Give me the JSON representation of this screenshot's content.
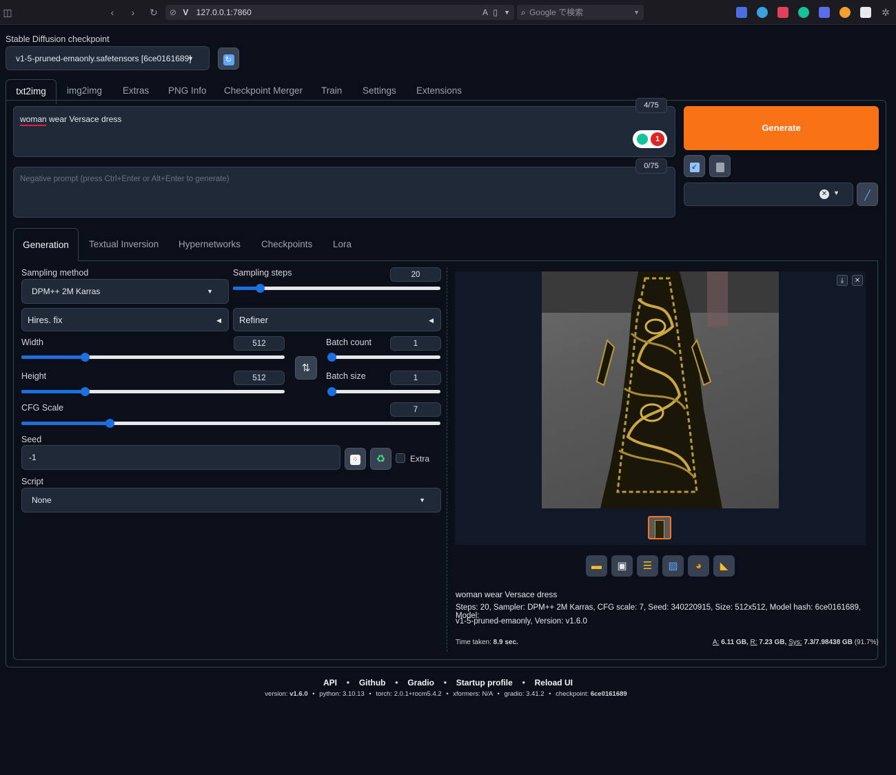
{
  "browser": {
    "url": "127.0.0.1:7860",
    "search_placeholder": "Google で検索"
  },
  "checkpoint": {
    "label": "Stable Diffusion checkpoint",
    "value": "v1-5-pruned-emaonly.safetensors [6ce0161689]"
  },
  "main_tabs": [
    "txt2img",
    "img2img",
    "Extras",
    "PNG Info",
    "Checkpoint Merger",
    "Train",
    "Settings",
    "Extensions"
  ],
  "prompt": {
    "value": "woman wear Versace dress",
    "token_count": "4/75",
    "badge_count": "1"
  },
  "negative_prompt": {
    "placeholder": "Negative prompt (press Ctrl+Enter or Alt+Enter to generate)",
    "token_count": "0/75"
  },
  "generate_label": "Generate",
  "sub_tabs": [
    "Generation",
    "Textual Inversion",
    "Hypernetworks",
    "Checkpoints",
    "Lora"
  ],
  "generation": {
    "sampling_method_label": "Sampling method",
    "sampling_method": "DPM++ 2M Karras",
    "sampling_steps_label": "Sampling steps",
    "sampling_steps": "20",
    "sampling_steps_fraction": 0.13,
    "hires_fix_label": "Hires. fix",
    "refiner_label": "Refiner",
    "width_label": "Width",
    "width": "512",
    "width_fraction": 0.24,
    "height_label": "Height",
    "height": "512",
    "height_fraction": 0.24,
    "batch_count_label": "Batch count",
    "batch_count": "1",
    "batch_count_fraction": 0.0,
    "batch_size_label": "Batch size",
    "batch_size": "1",
    "batch_size_fraction": 0.0,
    "cfg_scale_label": "CFG Scale",
    "cfg_scale": "7",
    "cfg_scale_fraction": 0.21,
    "seed_label": "Seed",
    "seed": "-1",
    "extra_label": "Extra",
    "script_label": "Script",
    "script": "None"
  },
  "output": {
    "prompt_text": "woman wear Versace dress",
    "info_line1": "Steps: 20, Sampler: DPM++ 2M Karras, CFG scale: 7, Seed: 340220915, Size: 512x512, Model hash: 6ce0161689, Model:",
    "info_line2": "v1-5-pruned-emaonly, Version: v1.6.0",
    "time_label": "Time taken:",
    "time_value": "8.9 sec.",
    "mem_a_label": "A:",
    "mem_a": "6.11 GB,",
    "mem_r_label": "R:",
    "mem_r": "7.23 GB,",
    "mem_sys_label": "Sys:",
    "mem_sys": "7.3/7.98438 GB",
    "mem_pct": "(91.7%)"
  },
  "footer": {
    "links": [
      "API",
      "Github",
      "Gradio",
      "Startup profile",
      "Reload UI"
    ],
    "version_label": "version:",
    "version": "v1.6.0",
    "python": "python: 3.10.13",
    "torch": "torch: 2.0.1+rocm5.4.2",
    "xformers": "xformers: N/A",
    "gradio": "gradio: 3.41.2",
    "checkpoint_label": "checkpoint:",
    "checkpoint": "6ce0161689"
  },
  "colors": {
    "accent": "#f97316",
    "slider": "#1d6fe0",
    "background": "#0b0f19"
  }
}
